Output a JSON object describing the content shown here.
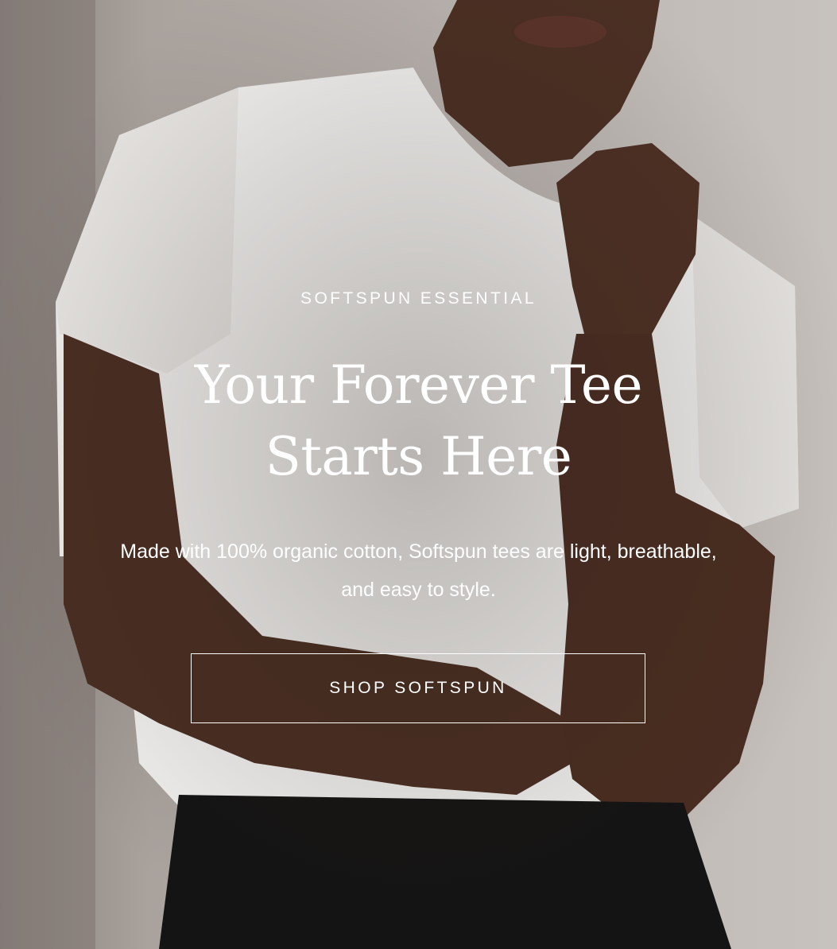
{
  "hero": {
    "eyebrow": "SOFTSPUN ESSENTIAL",
    "headline_line1": "Your Forever Tee",
    "headline_line2": "Starts Here",
    "body": "Made with 100% organic cotton, Softspun tees are light, breathable, and easy to style.",
    "cta_label": "SHOP SOFTSPUN",
    "image_alt": ""
  },
  "colors": {
    "text": "#ffffff",
    "background": "#bdb7b3",
    "tee": "#f2f1ef",
    "skin": "#4a2e22",
    "pants": "#141414"
  }
}
